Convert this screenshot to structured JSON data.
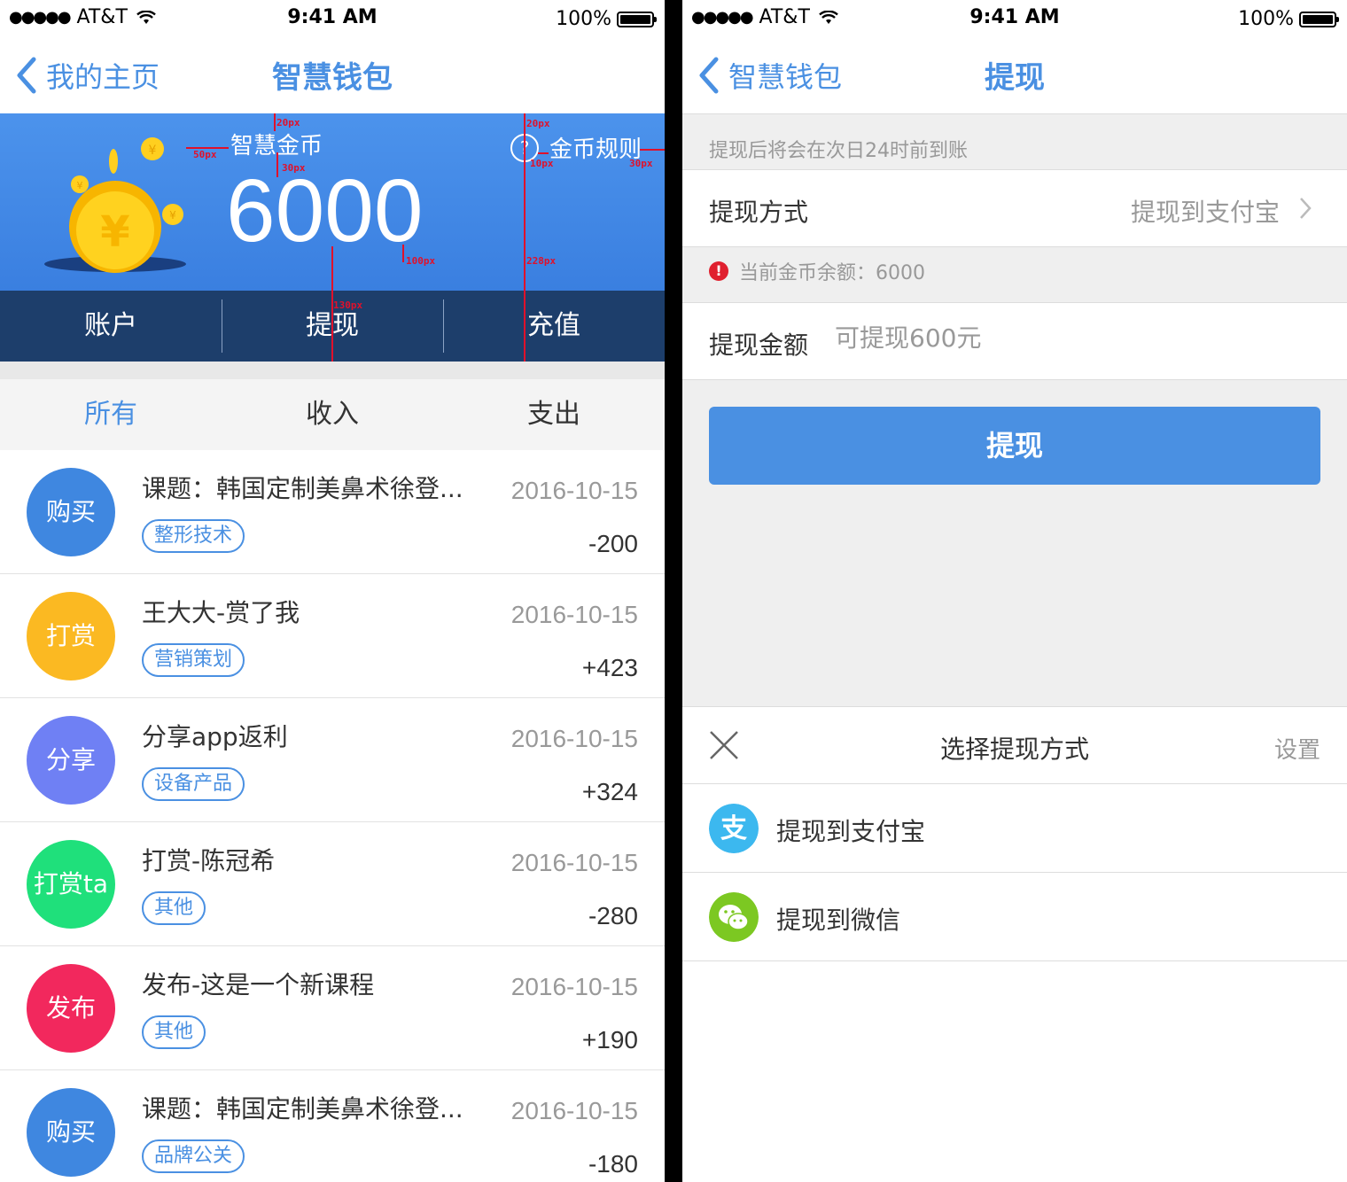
{
  "status": {
    "carrier": "AT&T",
    "time": "9:41 AM",
    "battery": "100%"
  },
  "left": {
    "nav": {
      "back_label": "我的主页",
      "title": "智慧钱包"
    },
    "hero": {
      "coin_label": "智慧金币",
      "balance": "6000",
      "rules_label": "金币规则"
    },
    "annotations": {
      "a1": "20px",
      "a2": "50px",
      "a3": "30px",
      "a4": "20px",
      "a5": "10px",
      "a6": "30px",
      "a7": "100px",
      "a8": "228px",
      "a9": "130px"
    },
    "action_tabs": [
      "账户",
      "提现",
      "充值"
    ],
    "filter_tabs": [
      "所有",
      "收入",
      "支出"
    ],
    "transactions": [
      {
        "avatar": "购买",
        "color": "#3f87e0",
        "title": "课题：韩国定制美鼻术徐登...",
        "tag": "整形技术",
        "date": "2016-10-15",
        "amount": "-200"
      },
      {
        "avatar": "打赏",
        "color": "#fbb922",
        "title": "王大大-赏了我",
        "tag": "营销策划",
        "date": "2016-10-15",
        "amount": "+423"
      },
      {
        "avatar": "分享",
        "color": "#6f80f4",
        "title": "分享app返利",
        "tag": "设备产品",
        "date": "2016-10-15",
        "amount": "+324"
      },
      {
        "avatar": "打赏ta",
        "color": "#1fe07b",
        "title": "打赏-陈冠希",
        "tag": "其他",
        "date": "2016-10-15",
        "amount": "-280"
      },
      {
        "avatar": "发布",
        "color": "#f2285d",
        "title": "发布-这是一个新课程",
        "tag": "其他",
        "date": "2016-10-15",
        "amount": "+190"
      },
      {
        "avatar": "购买",
        "color": "#3f87e0",
        "title": "课题：韩国定制美鼻术徐登...",
        "tag": "品牌公关",
        "date": "2016-10-15",
        "amount": "-180"
      }
    ]
  },
  "right": {
    "nav": {
      "back_label": "智慧钱包",
      "title": "提现"
    },
    "note": "提现后将会在次日24时前到账",
    "method_label": "提现方式",
    "method_value": "提现到支付宝",
    "balance_warning": "当前金币余额：6000",
    "amount_label": "提现金额",
    "amount_placeholder": "可提现600元",
    "submit_label": "提现",
    "sheet": {
      "title": "选择提现方式",
      "settings": "设置",
      "options": [
        {
          "label": "提现到支付宝",
          "icon": "alipay-icon",
          "color": "#3cb8ef"
        },
        {
          "label": "提现到微信",
          "icon": "wechat-icon",
          "color": "#7cc822"
        }
      ]
    }
  }
}
